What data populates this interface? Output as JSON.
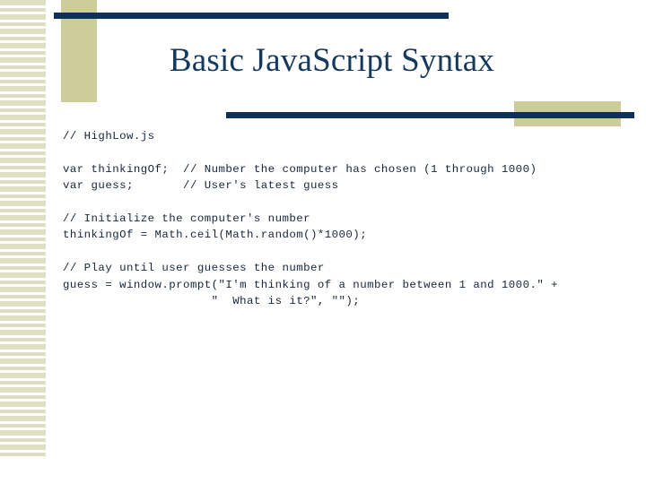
{
  "slide": {
    "title": "Basic JavaScript Syntax",
    "colors": {
      "navy": "#0d3158",
      "title_navy": "#14395f",
      "tan": "#cdcd9b",
      "stripe": "#dedfc4",
      "code_text": "#16263c",
      "background": "#ffffff"
    },
    "code_lines": [
      "// HighLow.js",
      "",
      "var thinkingOf;  // Number the computer has chosen (1 through 1000)",
      "var guess;       // User's latest guess",
      "",
      "// Initialize the computer's number",
      "thinkingOf = Math.ceil(Math.random()*1000);",
      "",
      "// Play until user guesses the number",
      "guess = window.prompt(\"I'm thinking of a number between 1 and 1000.\" +",
      "                     \"  What is it?\", \"\");"
    ]
  }
}
